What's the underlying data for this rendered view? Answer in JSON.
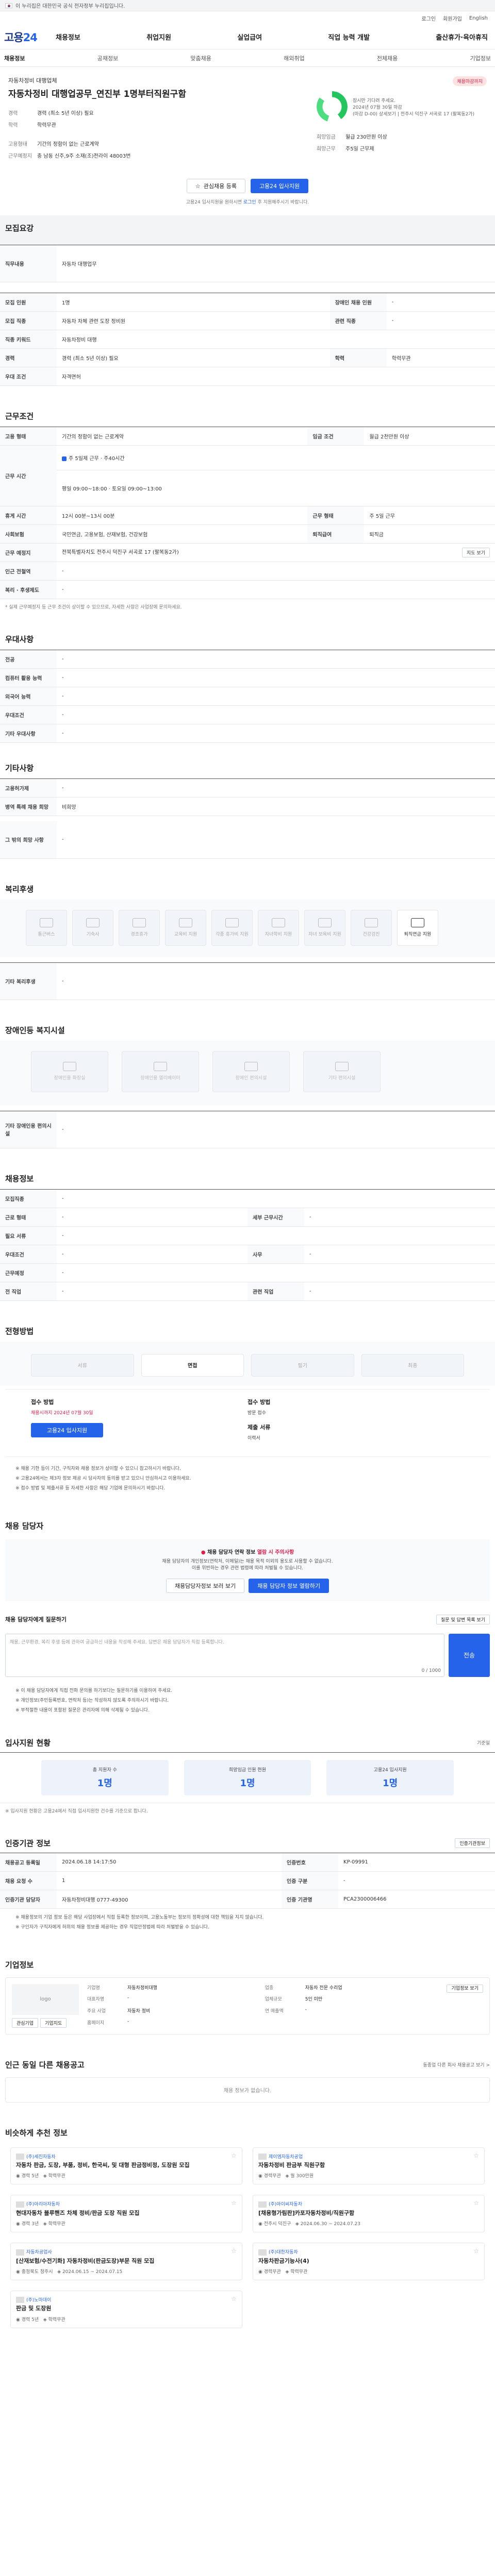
{
  "govbar": {
    "text": "이 누리집은 대한민국 공식 전자정부 누리집입니다."
  },
  "util": {
    "login": "로그인",
    "signup": "회원가입",
    "lang": "English"
  },
  "header": {
    "logo_a": "고용",
    "logo_b": "24",
    "menu": [
      "채용정보",
      "취업지원",
      "실업급여",
      "직업 능력 개발",
      "출산휴가·육아휴직"
    ]
  },
  "lnb": [
    "채용정보",
    "공채정보",
    "맞춤채용",
    "해외취업",
    "전체채용",
    "기업정보"
  ],
  "hero": {
    "company": "자동차정비 대행업체",
    "title": "자동차정비 대행업공무_연진부 1명부터직원구함",
    "rows": [
      {
        "k": "경력",
        "v": "경력 (최소 5년 이상) 필요"
      },
      {
        "k": "학력",
        "v": "학력무관"
      }
    ],
    "rows2": [
      {
        "k": "고용형태",
        "v": "기간의 정함이 없는 근로계약"
      },
      {
        "k": "근무예정지",
        "v": "충 남동 신주,9주 소재(조)전라이 48003번"
      }
    ],
    "loading": "잠시만 기다려 주세요.",
    "badge": "채용마감까지",
    "deadline": "2024년 07월 30일 마감",
    "deadline2": "(마감 D-00) 상세보기 | 전주시 덕진구 서곡로 17 (팔복동2가)",
    "right_k1": "희망임금",
    "right_v1": "월급 230만원 이상",
    "right_k2": "희망근무",
    "right_v2": "주5일 근무제",
    "btn_save": "관심채용 등록",
    "btn_apply": "고용24 입사지원",
    "note_a": "고용24 입사지원을 원하시면 ",
    "note_b": "로그인",
    "note_c": " 후 지원해주시기 바랍니다."
  },
  "recruit": {
    "title": "모집요강",
    "desc_k": "직무내용",
    "desc_v": "자동차 대행업무",
    "rows": [
      [
        "모집 인원",
        "1명",
        "장애인 채용 인원",
        "-"
      ],
      [
        "모집 직종",
        "자동차 차체 관련 도장 정비원",
        "관련 직종",
        "-"
      ],
      [
        "직종 키워드",
        "자동차정비 대행",
        "",
        ""
      ],
      [
        "경력",
        "경력 (최소 5년 이상) 필요",
        "학력",
        "학력무관"
      ],
      [
        "우대 조건",
        "자격면허",
        "",
        ""
      ]
    ]
  },
  "work": {
    "title": "근무조건",
    "rows": [
      [
        "고용 형태",
        "기간의 정함이 없는 근로계약",
        "임금 조건",
        "월급 2천만원 이상"
      ],
      [
        "근무 시간",
        "주 5일제 근무 · 주40시간",
        "",
        ""
      ],
      [
        "근무 시간",
        "평일 09:00~18:00 · 토요일 09:00~13:00",
        "",
        ""
      ],
      [
        "휴게 시간",
        "12시 00분~13시 00분",
        "근무 형태",
        "주 5일 근무"
      ],
      [
        "사회보험",
        "국민연금, 고용보험, 산재보험, 건강보험",
        "퇴직급여",
        "퇴직금"
      ],
      [
        "근무 예정지",
        "전북특별자치도 전주시 덕진구 서곡로 17 (팔복동2가)",
        "",
        ""
      ],
      [
        "인근 전철역",
        "-",
        "",
        ""
      ],
      [
        "복리 · 후생제도",
        "-",
        "",
        ""
      ]
    ],
    "map_btn": "지도 보기",
    "caption": "* 실제 근무예정지 등 근무 조건이 상이할 수 있으므로, 자세한 사항은 사업장에 문의하세요."
  },
  "pref": {
    "title": "우대사항",
    "rows": [
      [
        "전공",
        "-"
      ],
      [
        "컴퓨터 활용 능력",
        "-"
      ],
      [
        "외국어 능력",
        "-"
      ],
      [
        "우대조건",
        "-"
      ],
      [
        "기타 우대사항",
        "-"
      ]
    ]
  },
  "etc": {
    "title": "기타사항",
    "rows": [
      [
        "고용허가제",
        "-"
      ],
      [
        "병역 특례 채용 희망",
        "비희망"
      ]
    ]
  },
  "etc2": {
    "k": "그 밖의 희망 사항",
    "v": "-"
  },
  "welfare": {
    "title": "복리후생",
    "items": [
      "통근버스",
      "기숙사",
      "경조휴가",
      "교육비 지원",
      "각종 휴가비 지원",
      "자녀학비 지원",
      "자녀 보육비 지원",
      "건강검진",
      "퇴직연금 지원"
    ],
    "etc_k": "기타 복리후생",
    "etc_v": "-"
  },
  "disabled": {
    "title": "장애인등 복지시설",
    "items": [
      "장애인용 화장실",
      "장애인용 엘리베이터",
      "장애인 편의시설",
      "기타 편의시설"
    ],
    "etc_k": "기타 장애인용 편의시설",
    "etc_v": "-"
  },
  "company": {
    "title": "채용정보",
    "rows": [
      [
        "모집직종",
        "-",
        "",
        ""
      ],
      [
        "근로 형태",
        "-",
        "세부 근무시간",
        "-"
      ],
      [
        "필요 서류",
        "-",
        "",
        ""
      ],
      [
        "우대조건",
        "-",
        "사무",
        "-"
      ],
      [
        "근무예정",
        "-",
        "",
        ""
      ],
      [
        "전 직업",
        "-",
        "관련 직업",
        "-"
      ]
    ]
  },
  "process": {
    "title": "전형방법",
    "steps": [
      "서류",
      "면접",
      "필기",
      "최종"
    ],
    "apply_l": "접수 방법",
    "apply_l_v": "채용시까지 2024년 07월 30일",
    "apply_r": "접수 방법",
    "apply_r_v": "방문 접수",
    "etc_r": "제출 서류",
    "etc_rv": "이력서",
    "btn": "고용24 입사지원"
  },
  "bullets1": [
    "※ 채용 기한 등이 기간, 구직자와 채용 정보가 상이할 수 있으니 참고하시기 바랍니다.",
    "※ 고용24에서는 제3자 정보 제공 시 당사자의 동의를 받고 있으니 안심하시고 이용하세요.",
    "※ 접수 방법 및 제출서류 등 자세한 사항은 해당 기업에 문의하시기 바랍니다."
  ],
  "contact": {
    "title": "채용 담당자",
    "warn_a": "채용 담당자 연락 정보 ",
    "warn_b": "열람 시 주의사항",
    "p1": "채용 담당자의 개인정보(연락처, 이메일)는 채용 목적 이외의 용도로 사용할 수 없습니다.",
    "p2": "이를 위반하는 경우 관련 법령에 따라 처벌될 수 있습니다.",
    "btn1": "채용담당자정보 보러 보기",
    "btn2": "채용 담당자 정보 열람하기"
  },
  "qa": {
    "title": "채용 담당자에게 질문하기",
    "placeholder": "채용, 근무환경, 복리 후생 등에 관하여 궁금하신 내용을 작성해 주세요. 답변은 채용 담당자가 직접 등록합니다.",
    "count": "0 / 1000",
    "send": "전송",
    "link": "질문 및 답변 목록 보기"
  },
  "bullets2": [
    "※ 이 채용 담당자에게 직접 전화 문의를 하기보다는 질문하기를 이용하여 주세요.",
    "※ 개인정보(주민등록번호, 연락처 등)는 작성하지 않도록 주의하시기 바랍니다.",
    "※ 부적절한 내용이 포함된 질문은 관리자에 의해 삭제될 수 있습니다."
  ],
  "stats": {
    "title": "입사지원 현황",
    "date": "기준일 ",
    "items": [
      {
        "n": "총 지원자 수",
        "v": "1명"
      },
      {
        "n": "희망임금 인원 현원",
        "v": "1명"
      },
      {
        "n": "고용24 입사지원",
        "v": "1명"
      }
    ],
    "note": "※ 입사지원 현황은 고용24에서 직접 입사지원한 건수를 기준으로 합니다."
  },
  "info": {
    "title": "인증기관 정보",
    "btn": "인증기관정보",
    "rows": [
      [
        "채용공고 등록일",
        "2024.06.18 14:17:50",
        "인증번호",
        "KP-09991"
      ],
      [
        "채용 요청 수",
        "1",
        "인증 구분",
        "-"
      ],
      [
        "인증기관 담당자",
        "자동차정비대행 0777-49300",
        "인증 기관명",
        "PCA2300006466"
      ]
    ],
    "notes": [
      "※ 채용정보의 기업 정보 등은 해당 사업장에서 직접 등록한 정보이며, 고용노동부는 정보의 정확성에 대한 책임을 지지 않습니다.",
      "※ 구인자가 구직자에게 허위의 채용 정보를 제공하는 경우 직업안정법에 따라 처벌받을 수 있습니다."
    ]
  },
  "corp": {
    "title": "기업정보",
    "btn": "기업정보 보기",
    "logo": "logo",
    "grid": [
      [
        "기업명",
        "자동차정비대행",
        "업종",
        "자동차 전문 수리업"
      ],
      [
        "대표자명",
        "-",
        "업체규모",
        "5인 미만"
      ],
      [
        "주요 사업",
        "자동차 정비",
        "연 매출액",
        "-"
      ],
      [
        "홈페이지",
        "-",
        "",
        ""
      ]
    ],
    "b1": "관심기업",
    "b2": "기업지도"
  },
  "similar": {
    "title": "인근 동일 다른 채용공고",
    "link": "동종업 다른 회사 채용공고 보기 >",
    "empty": "채용 정보가 없습니다."
  },
  "reco": {
    "title": "비슷하게 추천 정보",
    "cards": [
      {
        "co": "(주)세진자동차",
        "tt": "자동차 판금, 도장, 부품, 정비, 한국씨, 및 대형 판금정비정, 도장원 모집",
        "m1": "경력 5년",
        "m2": "학력무관"
      },
      {
        "co": "제이엠자동차공업",
        "tt": "자동차정비 판금부 직원구함",
        "m1": "경력무관",
        "m2": "월 300만원"
      },
      {
        "co": "(주)아리아자동차",
        "tt": "현대자동차 블루핸즈 차체 정비/판금 도장 직원 모집",
        "m1": "경력 3년",
        "m2": "학력무관"
      },
      {
        "co": "(주)아이씨자동차",
        "tt": "[채용형가림판]카포자동차정비/직원구함",
        "m1": "전주시 덕진구",
        "m2": "2024.06.30 ~ 2024.07.23"
      },
      {
        "co": "자동차공업사",
        "tt": "[산재보험/수전기화] 자동차정비(판금도장)부문 직원 모집",
        "m1": "충청북도 청주시",
        "m2": "2024.06.15 ~ 2024.07.15"
      },
      {
        "co": "(주)대한자동차",
        "tt": "자동차판금기능사(4)",
        "m1": "경력무관",
        "m2": "학력무관"
      },
      {
        "co": "(주)노마데이",
        "tt": "판금 및 도장원",
        "m1": "경력 5년",
        "m2": "학력무관"
      }
    ]
  }
}
